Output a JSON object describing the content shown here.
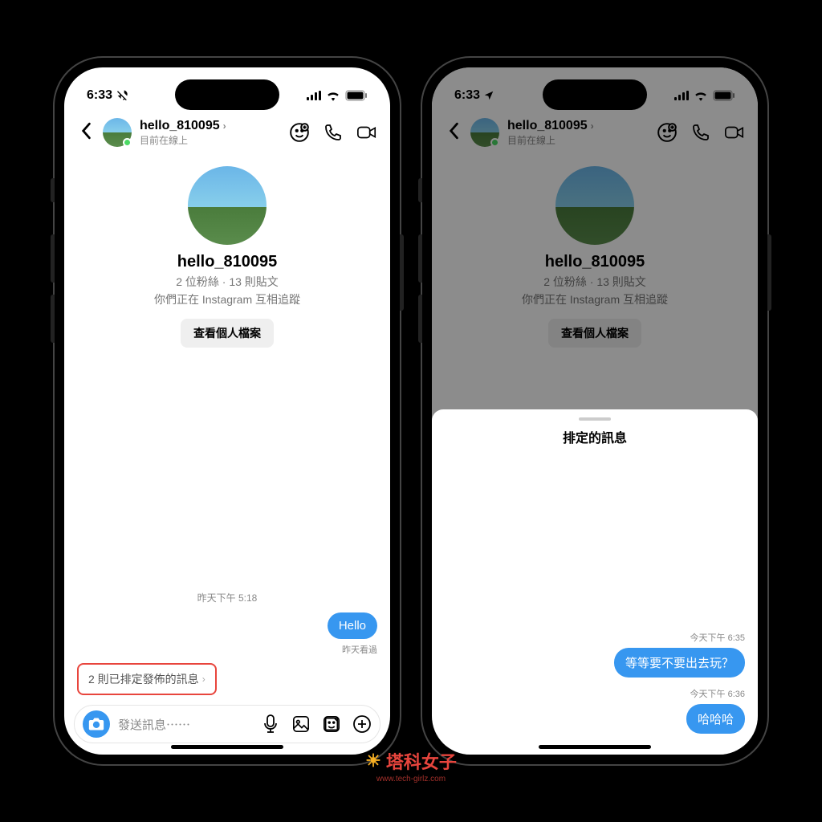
{
  "phone1": {
    "status": {
      "time": "6:33",
      "silent": true
    },
    "header": {
      "username": "hello_810095",
      "status_text": "目前在線上"
    },
    "profile": {
      "username": "hello_810095",
      "stats": "2 位粉絲 · 13 則貼文",
      "follow_text": "你們正在 Instagram 互相追蹤",
      "view_profile_label": "查看個人檔案"
    },
    "chat": {
      "timestamp": "昨天下午 5:18",
      "message1": "Hello",
      "seen_text": "昨天看過"
    },
    "scheduled_pill": "2 則已排定發佈的訊息",
    "input_placeholder": "發送訊息⋯⋯"
  },
  "phone2": {
    "status": {
      "time": "6:33",
      "location": true
    },
    "header": {
      "username": "hello_810095",
      "status_text": "目前在線上"
    },
    "profile": {
      "username": "hello_810095",
      "stats": "2 位粉絲 · 13 則貼文",
      "follow_text": "你們正在 Instagram 互相追蹤",
      "view_profile_label": "查看個人檔案"
    },
    "sheet": {
      "title": "排定的訊息",
      "ts1": "今天下午 6:35",
      "msg1": "等等要不要出去玩？",
      "ts2": "今天下午 6:36",
      "msg2": "哈哈哈"
    }
  },
  "watermark": {
    "main": "塔科女子",
    "sub": "www.tech-girlz.com"
  }
}
